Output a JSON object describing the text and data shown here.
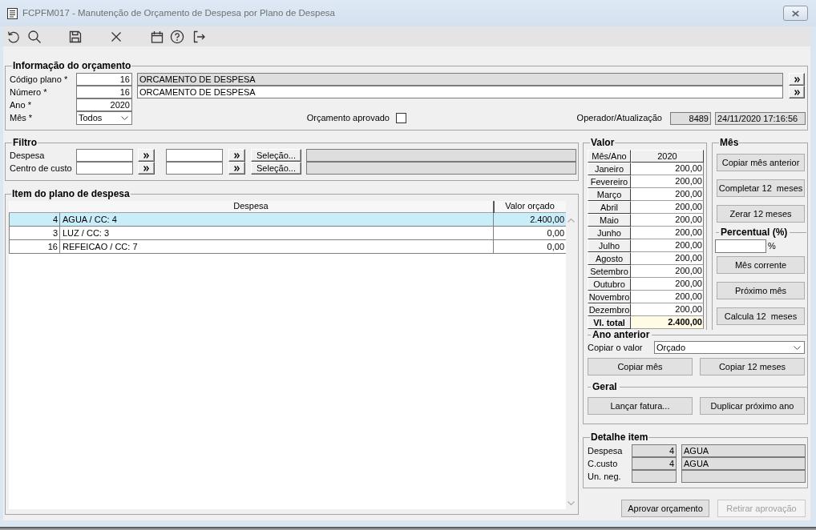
{
  "window": {
    "title": "FCPFM017 - Manutenção de Orçamento de Despesa por Plano de Despesa"
  },
  "info": {
    "title": "Informação do orçamento",
    "lookups": [
      {
        "label": "Código plano *",
        "value": "16",
        "description": "ORCAMENTO DE DESPESA",
        "description_readonly": true
      },
      {
        "label": "Número *",
        "value": "16",
        "description": "ORCAMENTO DE DESPESA",
        "description_readonly": false
      }
    ],
    "year": {
      "label": "Ano *",
      "value": "2020"
    },
    "month": {
      "label": "Mês *",
      "value": "Todos"
    },
    "approved": {
      "label": "Orçamento aprovado",
      "checked": false
    },
    "operator": {
      "label": "Operador/Atualização",
      "code": "8489",
      "updated": "24/11/2020 17:16:56"
    }
  },
  "filter": {
    "title": "Filtro",
    "rows": [
      {
        "label": "Despesa",
        "button": "Seleção..."
      },
      {
        "label": "Centro de custo",
        "button": "Seleção..."
      }
    ]
  },
  "items": {
    "title": "Item do plano de despesa",
    "columns": [
      "Despesa",
      "Valor orçado"
    ],
    "rows": [
      {
        "code": "4",
        "despesa": "AGUA / CC: 4",
        "valor": "2.400,00",
        "selected": true
      },
      {
        "code": "3",
        "despesa": "LUZ / CC: 3",
        "valor": "0,00",
        "selected": false
      },
      {
        "code": "16",
        "despesa": "REFEICAO / CC: 7",
        "valor": "0,00",
        "selected": false
      }
    ]
  },
  "valor": {
    "title": "Valor",
    "columns": [
      "Mês/Ano",
      "2020"
    ],
    "months": [
      {
        "month": "Janeiro",
        "value": "200,00"
      },
      {
        "month": "Fevereiro",
        "value": "200,00"
      },
      {
        "month": "Março",
        "value": "200,00"
      },
      {
        "month": "Abril",
        "value": "200,00"
      },
      {
        "month": "Maio",
        "value": "200,00"
      },
      {
        "month": "Junho",
        "value": "200,00"
      },
      {
        "month": "Julho",
        "value": "200,00"
      },
      {
        "month": "Agosto",
        "value": "200,00"
      },
      {
        "month": "Setembro",
        "value": "200,00"
      },
      {
        "month": "Outubro",
        "value": "200,00"
      },
      {
        "month": "Novembro",
        "value": "200,00"
      },
      {
        "month": "Dezembro",
        "value": "200,00"
      }
    ],
    "total": {
      "label": "Vl. total",
      "value": "2.400,00"
    }
  },
  "mes": {
    "title": "Mês",
    "buttons": [
      "Copiar mês anterior",
      "Completar 12  meses",
      "Zerar 12 meses"
    ],
    "percentual": {
      "title": "Percentual (%)",
      "unit": "%"
    },
    "percent_buttons": [
      "Mês corrente",
      "Próximo mês",
      "Calcula 12  meses"
    ]
  },
  "ano_anterior": {
    "title": "Ano anterior",
    "label": "Copiar o valor",
    "value": "Orçado",
    "buttons": [
      "Copiar mês",
      "Copiar 12 meses"
    ]
  },
  "geral": {
    "title": "Geral",
    "buttons": [
      "Lançar fatura...",
      "Duplicar próximo ano"
    ]
  },
  "detalhe": {
    "title": "Detalhe item",
    "rows": [
      {
        "label": "Despesa",
        "code": "4",
        "name": "AGUA"
      },
      {
        "label": "C.custo",
        "code": "4",
        "name": "AGUA"
      },
      {
        "label": "Un. neg."
      }
    ]
  },
  "actions": [
    {
      "label": "Aprovar orçamento",
      "disabled": false
    },
    {
      "label": "Retirar aprovação",
      "disabled": true
    }
  ]
}
